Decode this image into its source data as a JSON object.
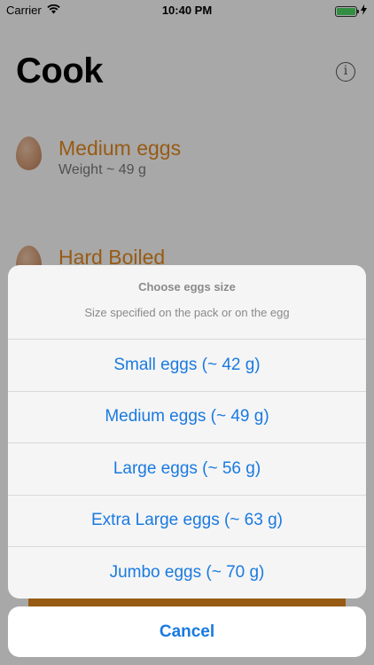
{
  "status": {
    "carrier": "Carrier",
    "time": "10:40 PM"
  },
  "screen": {
    "title": "Cook",
    "info_icon": "i",
    "eggs": [
      {
        "title": "Medium eggs",
        "subtitle": "Weight ~ 49 g"
      },
      {
        "title": "Hard Boiled",
        "subtitle": ""
      }
    ]
  },
  "sheet": {
    "title": "Choose eggs size",
    "message": "Size specified on the pack or on the egg",
    "options": [
      "Small eggs (~ 42 g)",
      "Medium eggs (~ 49 g)",
      "Large eggs (~ 56 g)",
      "Extra Large eggs (~ 63 g)",
      "Jumbo eggs (~ 70 g)"
    ],
    "cancel": "Cancel"
  },
  "colors": {
    "accent_orange": "#e68a1f",
    "action_blue": "#1a7ae0",
    "battery_green": "#4cd964"
  },
  "battery_level": 1.0
}
